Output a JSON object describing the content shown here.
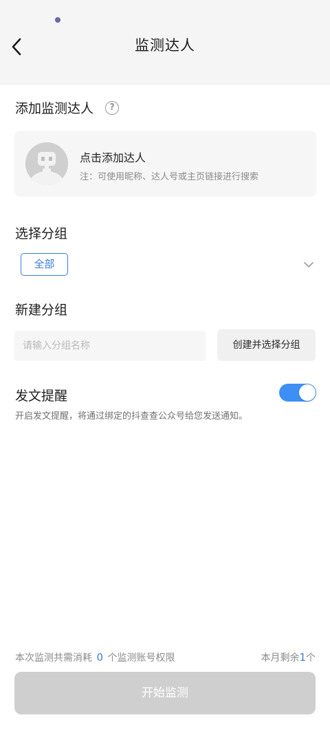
{
  "header": {
    "title": "监测达人",
    "back_icon": "chevron-left-icon"
  },
  "add_section": {
    "title": "添加监测达人",
    "help_icon": "question-circle-icon",
    "card_title": "点击添加达人",
    "card_hint": "注：可使用昵称、达人号或主页链接进行搜索",
    "avatar_icon": "robot-avatar-icon"
  },
  "group_select": {
    "title": "选择分组",
    "selected": "全部",
    "expand_icon": "chevron-down-icon"
  },
  "new_group": {
    "title": "新建分组",
    "placeholder": "请输入分组名称",
    "value": "",
    "button_label": "创建并选择分组"
  },
  "notification": {
    "title": "发文提醒",
    "description": "开启发文提醒，将通过绑定的抖查查公众号给您发送通知。",
    "enabled": true
  },
  "footer": {
    "cost_prefix": "本次监测共需消耗",
    "cost_count": "0",
    "cost_suffix": "个监测账号权限",
    "remaining_prefix": "本月剩余",
    "remaining_count": "1",
    "remaining_suffix": "个",
    "start_label": "开始监测"
  },
  "colors": {
    "accent": "#3a7bd5",
    "toggle_on": "#3d8ef5",
    "disabled_button": "#cfcfcf",
    "header_bg": "#f5f5f5"
  }
}
